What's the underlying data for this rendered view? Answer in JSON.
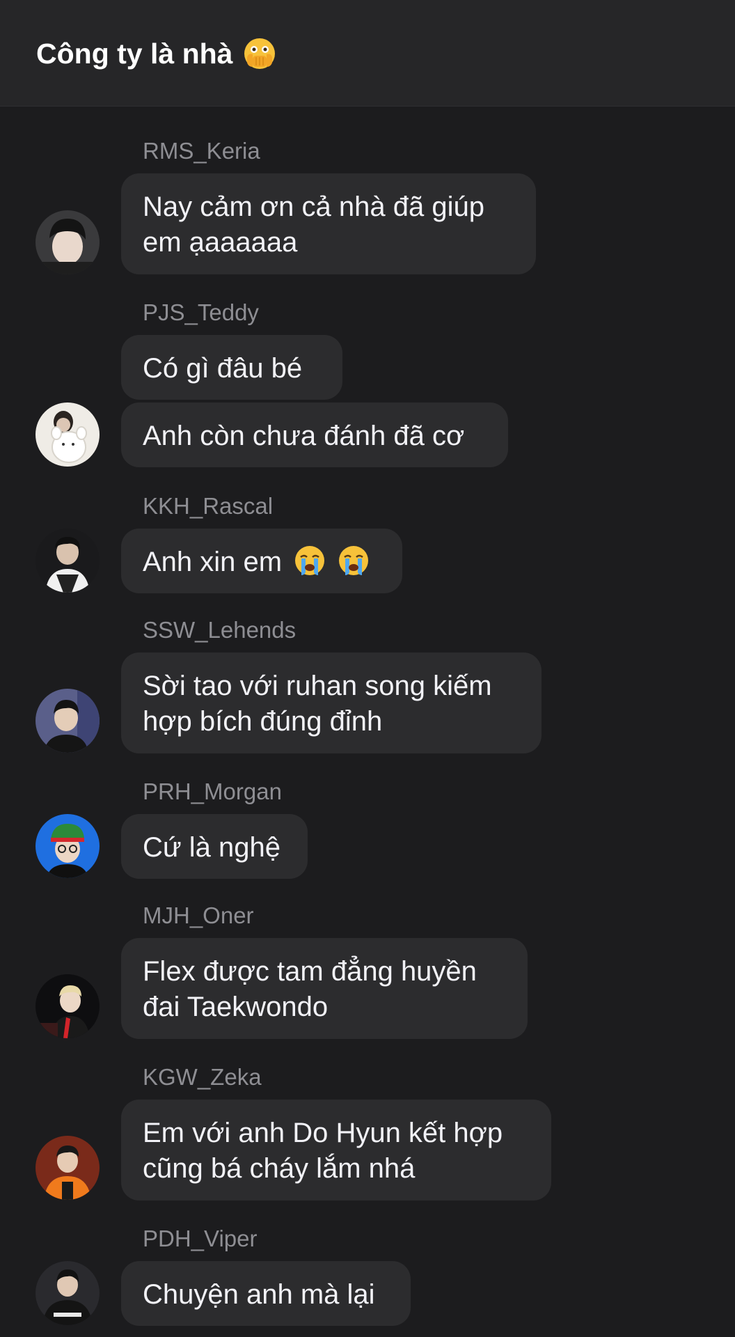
{
  "header": {
    "title": "Công ty là nhà",
    "title_emoji": "face-with-open-eyes-and-hand-over-mouth-icon"
  },
  "messages": [
    {
      "sender": "RMS_Keria",
      "bubbles": [
        "Nay cảm ơn cả nhà đã giúp",
        "em ạaaaaaa"
      ]
    },
    {
      "sender": "PJS_Teddy",
      "bubbles": [
        "Có gì đâu bé",
        "Anh còn chưa đánh đã cơ"
      ]
    },
    {
      "sender": "KKH_Rascal",
      "bubbles": [
        "Anh xin em"
      ],
      "emoji": "loudly-crying-face-icon"
    },
    {
      "sender": "SSW_Lehends",
      "bubbles": [
        "Sời tao với ruhan song kiếm",
        "hợp bích đúng đỉnh"
      ]
    },
    {
      "sender": "PRH_Morgan",
      "bubbles": [
        "Cứ là nghệ"
      ]
    },
    {
      "sender": "MJH_Oner",
      "bubbles": [
        "Flex được tam đẳng huyền",
        "đai Taekwondo"
      ]
    },
    {
      "sender": "KGW_Zeka",
      "bubbles": [
        "Em với anh Do Hyun kết hợp",
        "cũng bá cháy lắm nhá"
      ]
    },
    {
      "sender": "PDH_Viper",
      "bubbles": [
        "Chuyện anh mà lại"
      ]
    }
  ],
  "colors": {
    "background": "#1c1c1e",
    "header": "#262628",
    "bubble": "#2c2c2e",
    "sender": "#8e8e93"
  }
}
